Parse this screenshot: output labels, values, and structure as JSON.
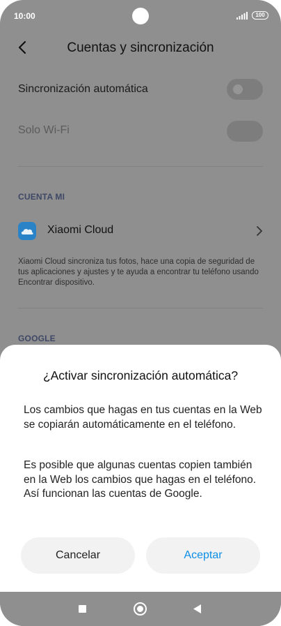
{
  "status_bar": {
    "time": "10:00",
    "battery": "100"
  },
  "header": {
    "title": "Cuentas y sincronización"
  },
  "settings": {
    "auto_sync_label": "Sincronización automática",
    "wifi_only_label": "Solo Wi-Fi"
  },
  "mi_account": {
    "section_label": "CUENTA MI",
    "cloud_label": "Xiaomi Cloud",
    "cloud_description": "Xiaomi Cloud sincroniza tus fotos, hace una copia de seguridad de tus aplicaciones y ajustes y te ayuda a encontrar tu teléfono usando Encontrar dispositivo."
  },
  "google": {
    "section_label": "GOOGLE"
  },
  "dialog": {
    "title": "¿Activar sincronización automática?",
    "paragraph1": "Los cambios que hagas en tus cuentas en la Web se copiarán automáticamente en el teléfono.",
    "paragraph2": "Es posible que algunas cuentas copien también en la Web los cambios que hagas en el teléfono. Así funcionan las cuentas de Google.",
    "cancel_label": "Cancelar",
    "accept_label": "Aceptar"
  },
  "colors": {
    "accent": "#0c8ee6",
    "overlay": "#8f8f8f",
    "cloud_icon": "#2a82c7"
  }
}
